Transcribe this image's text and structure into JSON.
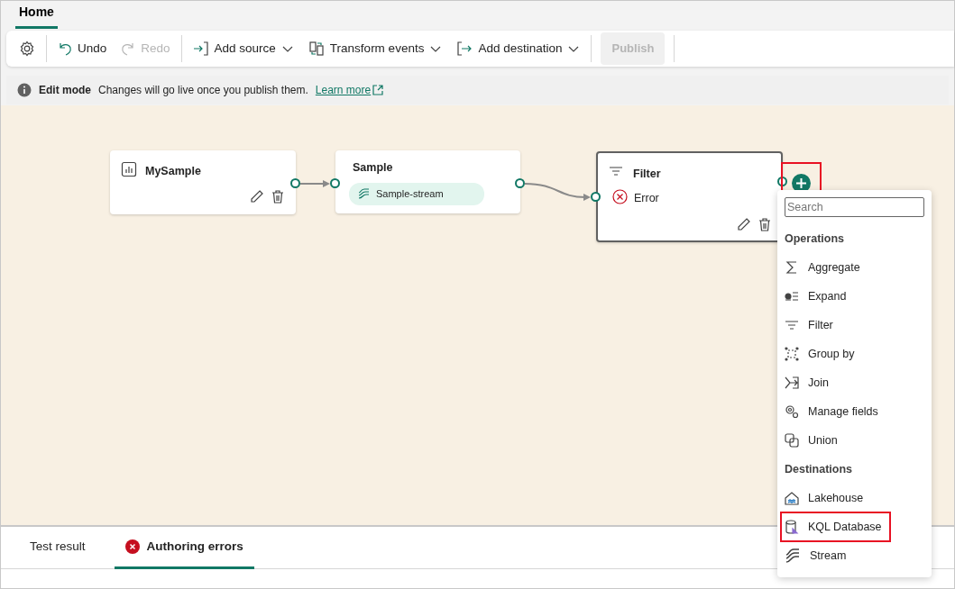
{
  "tabs": [
    {
      "label": "Home",
      "selected": true
    }
  ],
  "toolbar": [
    {
      "kind": "settings"
    },
    {
      "kind": "undo",
      "label": "Undo",
      "disabled": false
    },
    {
      "kind": "redo",
      "label": "Redo",
      "disabled": true
    },
    {
      "kind": "source",
      "label": "Add source",
      "disabled": false
    },
    {
      "kind": "transform",
      "label": "Transform events",
      "disabled": false
    },
    {
      "kind": "destination",
      "label": "Add destination",
      "disabled": false
    },
    {
      "kind": "publish",
      "label": "Publish",
      "disabled": true
    }
  ],
  "info_bar": {
    "title": "Edit mode",
    "message": "Changes will go live once you publish them.",
    "link": "Learn more"
  },
  "canvas": {
    "nodes": [
      {
        "kind": "source",
        "title": "MySample",
        "selected": false
      },
      {
        "kind": "stream",
        "title": "Sample",
        "chip": "Sample-stream",
        "selected": false
      },
      {
        "kind": "operation",
        "title": "Filter",
        "status": "Error",
        "selected": true
      }
    ],
    "add_button": {
      "highlighted": true
    }
  },
  "menu": {
    "search": {
      "placeholder": "Search"
    },
    "sections": [
      {
        "title": "Operations",
        "items": [
          {
            "kind": "sigma",
            "label": "Aggregate",
            "highlighted": false
          },
          {
            "kind": "expand",
            "label": "Expand",
            "highlighted": false
          },
          {
            "kind": "filter",
            "label": "Filter",
            "highlighted": false
          },
          {
            "kind": "group",
            "label": "Group by",
            "highlighted": false
          },
          {
            "kind": "join",
            "label": "Join",
            "highlighted": false
          },
          {
            "kind": "gears",
            "label": "Manage fields",
            "highlighted": false
          },
          {
            "kind": "union",
            "label": "Union",
            "highlighted": false
          }
        ]
      },
      {
        "title": "Destinations",
        "items": [
          {
            "kind": "lakehouse",
            "label": "Lakehouse",
            "highlighted": false
          },
          {
            "kind": "database",
            "label": "KQL Database",
            "highlighted": true
          },
          {
            "kind": "stream",
            "label": "Stream",
            "highlighted": false
          }
        ]
      }
    ]
  },
  "bottom_tabs": [
    {
      "label": "Test result",
      "selected": false,
      "error": false
    },
    {
      "label": "Authoring errors",
      "selected": true,
      "error": true
    }
  ]
}
